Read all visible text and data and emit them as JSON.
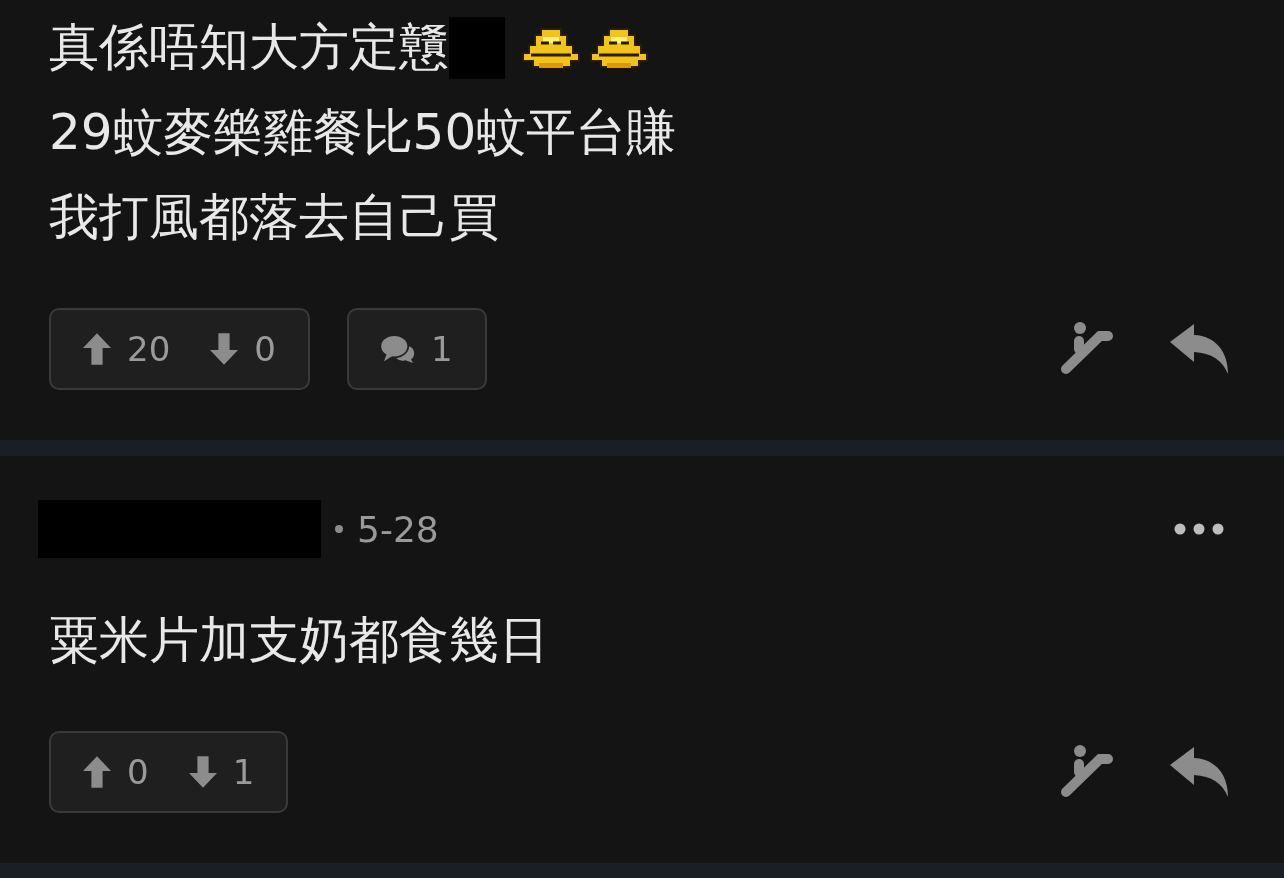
{
  "posts": [
    {
      "lines": [
        {
          "text": "真係唔知大方定戇",
          "redacted_tail": true,
          "stickers": [
            {
              "kind": "sticker"
            },
            {
              "kind": "sticker"
            }
          ]
        },
        {
          "text": "29蚊麥樂雞餐比50蚊平台賺",
          "redacted_tail": false
        },
        {
          "text": "我打風都落去自己買",
          "redacted_tail": false
        }
      ],
      "upvotes": "20",
      "downvotes": "0",
      "comments": "1"
    },
    {
      "header": {
        "author_redacted": true,
        "date": "5-28"
      },
      "lines": [
        {
          "text": "粟米片加支奶都食幾日",
          "redacted_tail": false
        }
      ],
      "upvotes": "0",
      "downvotes": "1"
    }
  ]
}
